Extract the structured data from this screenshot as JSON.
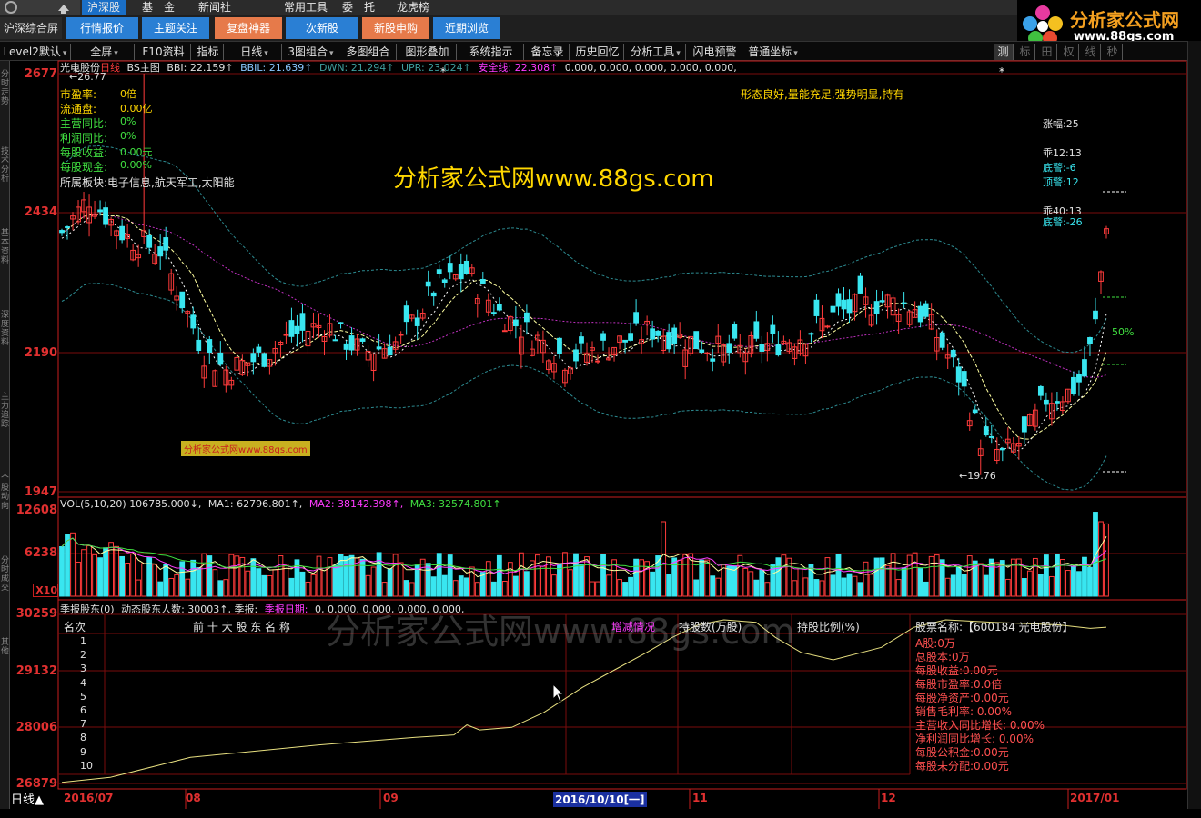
{
  "topbar": {
    "items": [
      "沪深股",
      "基　金",
      "新闻社",
      "常用工具",
      "委　托",
      "龙虎榜"
    ]
  },
  "nav": {
    "tabs": [
      "沪深综合屏",
      "行情报价",
      "主题关注",
      "复盘神器",
      "次新股",
      "新股申购",
      "近期浏览"
    ]
  },
  "brand": {
    "title": "分析家公式网",
    "url": "www.88gs.com"
  },
  "toolbar": {
    "items": [
      "Level2默认",
      "全屏",
      "F10资料",
      "指标",
      "日线",
      "3图组合",
      "多图组合",
      "图形叠加",
      "系统指示",
      "备忘录",
      "历史回忆",
      "分析工具",
      "闪电预警",
      "普通坐标",
      "测"
    ],
    "right_items": [
      "标",
      "田",
      "权",
      "线",
      "秒"
    ]
  },
  "leftbar": {
    "labels": [
      "分时走势",
      "技术分析",
      "基本资料",
      "深度资料",
      "主力追踪",
      "个股动向",
      "分时成交",
      "其他"
    ]
  },
  "main": {
    "title": "光电股份",
    "period": "日线",
    "indicator": "BS主图",
    "bbi": "BBI: 22.159↑",
    "bbil": "BBIL: 21.639↑",
    "dwn": "DWN: 21.294↑",
    "upr": "UPR: 23.024↑",
    "safe_label": "安全线:",
    "safe_val": "22.308↑",
    "zeros": "0.000, 0.000, 0.000, 0.000, 0.000,",
    "high_mark": "26.77",
    "low_mark": "19.76",
    "info": [
      {
        "k": "市盈率:",
        "v": "0倍",
        "color": "#ffd700"
      },
      {
        "k": "流通盘:",
        "v": "0.00亿",
        "color": "#ffd700"
      },
      {
        "k": "主营同比:",
        "v": "0%",
        "color": "#40e040"
      },
      {
        "k": "利润同比:",
        "v": "0%",
        "color": "#40e040"
      },
      {
        "k": "每股收益:",
        "v": "0.00元",
        "color": "#40e040"
      },
      {
        "k": "每股现金:",
        "v": "0.00%",
        "color": "#40e040"
      }
    ],
    "sector": "所属板块:电子信息,航天军工,太阳能",
    "watermark": "分析家公式网www.88gs.com",
    "comment": "形态良好,量能充足,强势明显,持有",
    "right_info": {
      "zhangfu": "涨幅:25",
      "guai12": "乖12:13",
      "dijing1": "底警:-6",
      "dingjing": "顶警:12",
      "guai40": "乖40:13",
      "dijing2": "底警:-26",
      "pct": "50%"
    },
    "small_wm": "分析家公式网www.88gs.com",
    "axis": [
      "2677",
      "2434",
      "2190",
      "1947"
    ]
  },
  "vol": {
    "label": "VOL(5,10,20)",
    "val": "106785.000↓,",
    "ma1": "MA1: 62796.801↑,",
    "ma2": "MA2: 38142.398↑,",
    "ma3": "MA3: 32574.801↑",
    "axis": [
      "12608",
      "6238"
    ],
    "unit": "X10"
  },
  "holders": {
    "title": "季报股东(0)",
    "dyn": "动态股东人数: 30003↑,",
    "season": "季报:",
    "date_label": "季报日期:",
    "zeros": "0, 0.000, 0.000, 0.000, 0.000,",
    "cols": [
      "名次",
      "前 十 大 股 东 名 称",
      "增减情况",
      "持股数(万股)",
      "持股比例(%)"
    ],
    "ranks": [
      "1",
      "2",
      "3",
      "4",
      "5",
      "6",
      "7",
      "8",
      "9",
      "10"
    ],
    "stock_name": "股票名称:【600184 光电股份】",
    "stock_info": [
      "A股:0万",
      "总股本:0万",
      "每股收益:0.00元",
      "每股市盈率:0.0倍",
      "每股净资产:0.00元",
      "销售毛利率: 0.00%",
      "主营收入同比增长: 0.00%",
      "净利润同比增长: 0.00%",
      "每股公积金:0.00元",
      "每股未分配:0.00元"
    ],
    "watermark": "分析家公式网www.88gs.com",
    "axis": [
      "30259",
      "29132",
      "28006",
      "26879"
    ]
  },
  "xaxis": {
    "period_btn": "日线▲",
    "labels": [
      "2016/07",
      "08",
      "09",
      "2016/10/10[一]",
      "11",
      "12",
      "2017/01"
    ]
  },
  "colors": {
    "up": "#ff3b3b",
    "down": "#39e6f0",
    "axis_red": "#c81e1e",
    "grid": "#7a0c0c"
  },
  "chart_data": {
    "type": "candlestick",
    "title": "光电股份 日线",
    "price_range": [
      19.47,
      26.77
    ],
    "high": 26.77,
    "low": 19.76,
    "x_labels": [
      "2016/07",
      "08",
      "09",
      "2016/10/10",
      "11",
      "12",
      "2017/01"
    ],
    "indicators": {
      "BBI": 22.159,
      "BBIL": 21.639,
      "DWN": 21.294,
      "UPR": 23.024,
      "安全线": 22.308
    },
    "volume": {
      "last": 106785.0,
      "MA1": 62796.801,
      "MA2": 38142.398,
      "MA3": 32574.801,
      "ylim": [
        0,
        12608
      ]
    },
    "holders_range": [
      26879,
      30259
    ],
    "dynamic_holders": 30003
  }
}
